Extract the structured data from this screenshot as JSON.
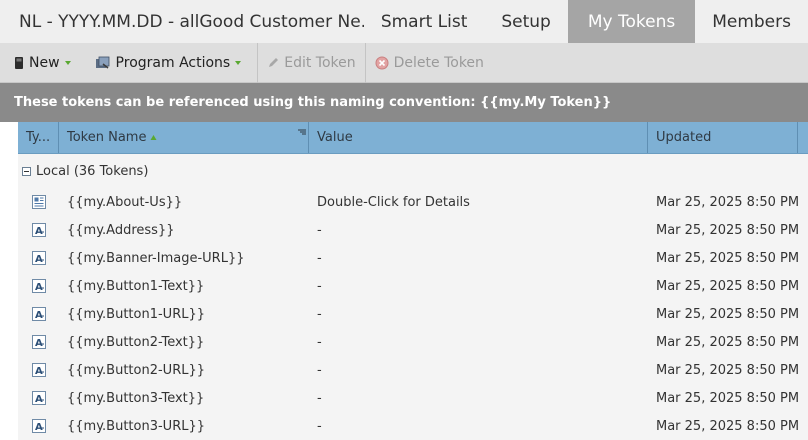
{
  "header": {
    "program_title": "NL - YYYY.MM.DD - allGood Customer Ne...",
    "tabs": [
      {
        "label": "Smart List"
      },
      {
        "label": "Setup"
      },
      {
        "label": "My Tokens",
        "active": true
      },
      {
        "label": "Members"
      }
    ]
  },
  "toolbar": {
    "new_label": "New",
    "program_actions_label": "Program Actions",
    "edit_token_label": "Edit Token",
    "delete_token_label": "Delete Token"
  },
  "info_text": "These tokens can be referenced using this naming convention: {{my.My Token}}",
  "grid": {
    "columns": {
      "type": "Ty...",
      "token_name": "Token Name",
      "value": "Value",
      "updated": "Updated"
    },
    "group_label": "Local (36 Tokens)",
    "rows": [
      {
        "icon": "rich-text-token-icon",
        "name": "{{my.About-Us}}",
        "value": "Double-Click for Details",
        "updated": "Mar 25, 2025 8:50 PM"
      },
      {
        "icon": "text-token-icon",
        "name": "{{my.Address}}",
        "value": "-",
        "updated": "Mar 25, 2025 8:50 PM"
      },
      {
        "icon": "text-token-icon",
        "name": "{{my.Banner-Image-URL}}",
        "value": "-",
        "updated": "Mar 25, 2025 8:50 PM"
      },
      {
        "icon": "text-token-icon",
        "name": "{{my.Button1-Text}}",
        "value": "-",
        "updated": "Mar 25, 2025 8:50 PM"
      },
      {
        "icon": "text-token-icon",
        "name": "{{my.Button1-URL}}",
        "value": "-",
        "updated": "Mar 25, 2025 8:50 PM"
      },
      {
        "icon": "text-token-icon",
        "name": "{{my.Button2-Text}}",
        "value": "-",
        "updated": "Mar 25, 2025 8:50 PM"
      },
      {
        "icon": "text-token-icon",
        "name": "{{my.Button2-URL}}",
        "value": "-",
        "updated": "Mar 25, 2025 8:50 PM"
      },
      {
        "icon": "text-token-icon",
        "name": "{{my.Button3-Text}}",
        "value": "-",
        "updated": "Mar 25, 2025 8:50 PM"
      },
      {
        "icon": "text-token-icon",
        "name": "{{my.Button3-URL}}",
        "value": "-",
        "updated": "Mar 25, 2025 8:50 PM"
      }
    ]
  },
  "colors": {
    "active_tab": "#a5a5a5",
    "header_blue": "#7eb0d4",
    "info_bar": "#8a8a8a",
    "caret_green": "#5aa832"
  }
}
